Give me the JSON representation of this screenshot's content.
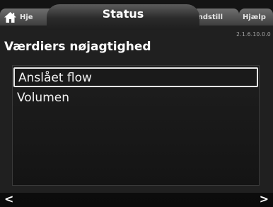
{
  "tabs": {
    "home_label": "Hje",
    "status_label": "Status",
    "settings_label": "Indstill",
    "help_label": "Hjælp"
  },
  "version": "2.1.6.10.0.0",
  "page": {
    "title": "Værdiers nøjagtighed"
  },
  "list": {
    "items": [
      {
        "label": "Anslået flow",
        "selected": true
      },
      {
        "label": "Volumen",
        "selected": false
      }
    ]
  },
  "nav": {
    "prev": "<",
    "next": ">"
  },
  "icons": {
    "home": "home-icon"
  },
  "colors": {
    "background": "#202020",
    "tab": "#5b5b5b",
    "text": "#ffffff"
  }
}
